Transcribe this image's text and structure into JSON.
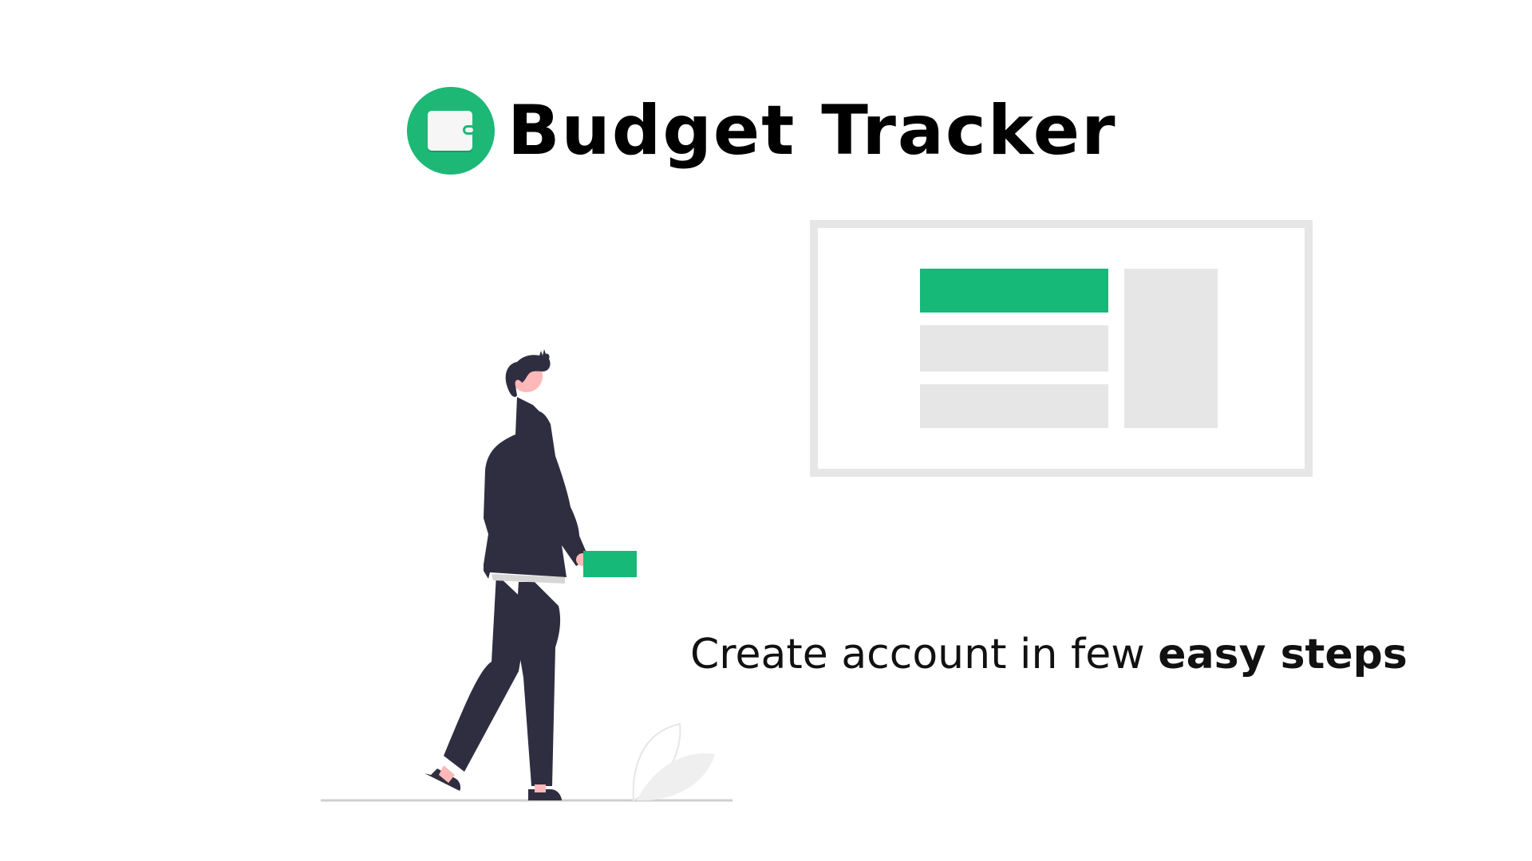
{
  "brand": {
    "title": "Budget Tracker",
    "logo_icon": "wallet-icon",
    "accent_color": "#1db876"
  },
  "tagline": {
    "plain": "Create account in few ",
    "emphasis": "easy steps"
  },
  "illustration": {
    "figure": "walking-person-illustration",
    "card_color": "#16b977",
    "panel_color": "#e6e6e6"
  }
}
